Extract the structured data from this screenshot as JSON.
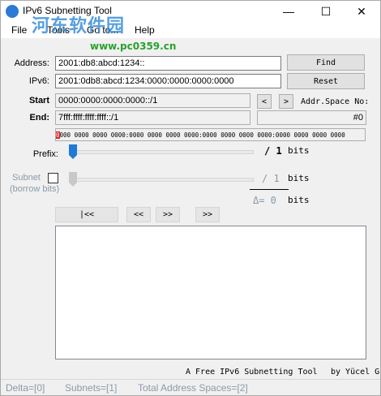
{
  "window": {
    "title": "IPv6 Subnetting Tool",
    "minimize": "—",
    "maximize": "☐",
    "close": "✕"
  },
  "watermark": {
    "text": "河东软件园",
    "url": "www.pc0359.cn"
  },
  "menu": [
    {
      "label": "File"
    },
    {
      "label": "Tools"
    },
    {
      "label": "Go to..."
    },
    {
      "label": "Help"
    }
  ],
  "form": {
    "address_label": "Address:",
    "address_value": "2001:db8:abcd:1234::",
    "find_label": "Find",
    "ipv6_label": "IPv6:",
    "ipv6_value": "2001:0db8:abcd:1234:0000:0000:0000:0000",
    "reset_label": "Reset",
    "start_label": "Start",
    "start_value": "0000:0000:0000:0000::/1",
    "prev_label": "<",
    "next_label": ">",
    "addr_space_label": "Addr.Space No:",
    "end_label": "End:",
    "end_value": "7fff:ffff:ffff:ffff::/1",
    "addr_space_value": "#0",
    "bits_first": "0",
    "bits_rest": "000 0000 0000 0000:0000 0000 0000 0000:0000 0000 0000 0000:0000 0000 0000 0000"
  },
  "prefix": {
    "label": "Prefix:",
    "value_text": "/ 1",
    "unit": "bits",
    "level": 1,
    "max": 64
  },
  "subnet": {
    "label": "Subnet",
    "sublabel": "(borrow bits)",
    "value_text": "/ 1",
    "unit": "bits",
    "level": 0,
    "checked": false
  },
  "delta": {
    "text": "Δ= 0",
    "unit": "bits"
  },
  "nav": {
    "first": "|<<",
    "prev": "<<",
    "next": ">>",
    "last": ">>"
  },
  "footer": {
    "left": "A Free IPv6 Subnetting Tool",
    "right": "by Yücel G"
  },
  "status": {
    "delta": "Delta=[0]",
    "subnets": "Subnets=[1]",
    "total": "Total Address Spaces=[2]"
  },
  "colors": {
    "slider_thumb": "#1e7ad6",
    "watermark_blue": "#3a8fd8",
    "watermark_green": "#29a12d",
    "status_text": "#8a9aa8",
    "bit_highlight": "#e02020"
  }
}
